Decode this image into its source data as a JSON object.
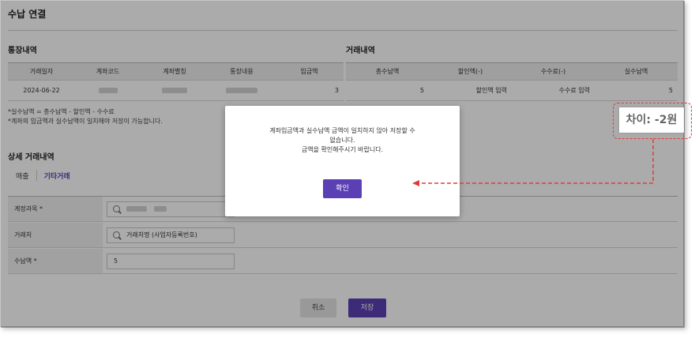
{
  "page": {
    "title": "수납 연결"
  },
  "bank": {
    "label": "통장내역",
    "headers": [
      "거래일자",
      "계좌코드",
      "계좌별칭",
      "통장내용",
      "입금액"
    ],
    "row": {
      "date": "2024-06-22",
      "amount": "3"
    }
  },
  "txn": {
    "label": "거래내역",
    "headers": [
      "총수납액",
      "할인액(-)",
      "수수료(-)",
      "실수납액"
    ],
    "row": {
      "total": "5",
      "discount_placeholder": "할인액 입력",
      "fee_placeholder": "수수료 입력",
      "net": "5"
    }
  },
  "notes": [
    "*실수납액 = 총수납액 - 할인액 - 수수료",
    "*계좌의 입금액과 실수납액이 일치해야 저장이 가능합니다."
  ],
  "detail": {
    "label": "상세 거래내역",
    "tabs": [
      "매출",
      "기타거래"
    ]
  },
  "form": {
    "account_label": "계정과목 *",
    "partner_label": "거래처",
    "partner_placeholder": "거래처명 (사업자등록번호)",
    "amount_label": "수납액 *",
    "amount_value": "5"
  },
  "buttons": {
    "cancel": "취소",
    "save": "저장"
  },
  "modal": {
    "line1": "계좌입금액과 실수납액 금액이 일치하지 않아 저장할 수",
    "line2": "없습니다.",
    "line3": "금액을 확인해주시기 바랍니다.",
    "ok": "확인"
  },
  "callout": {
    "text": "차이: -2원"
  },
  "colors": {
    "accent": "#5b3fb5",
    "annotation": "#e23a3a"
  }
}
